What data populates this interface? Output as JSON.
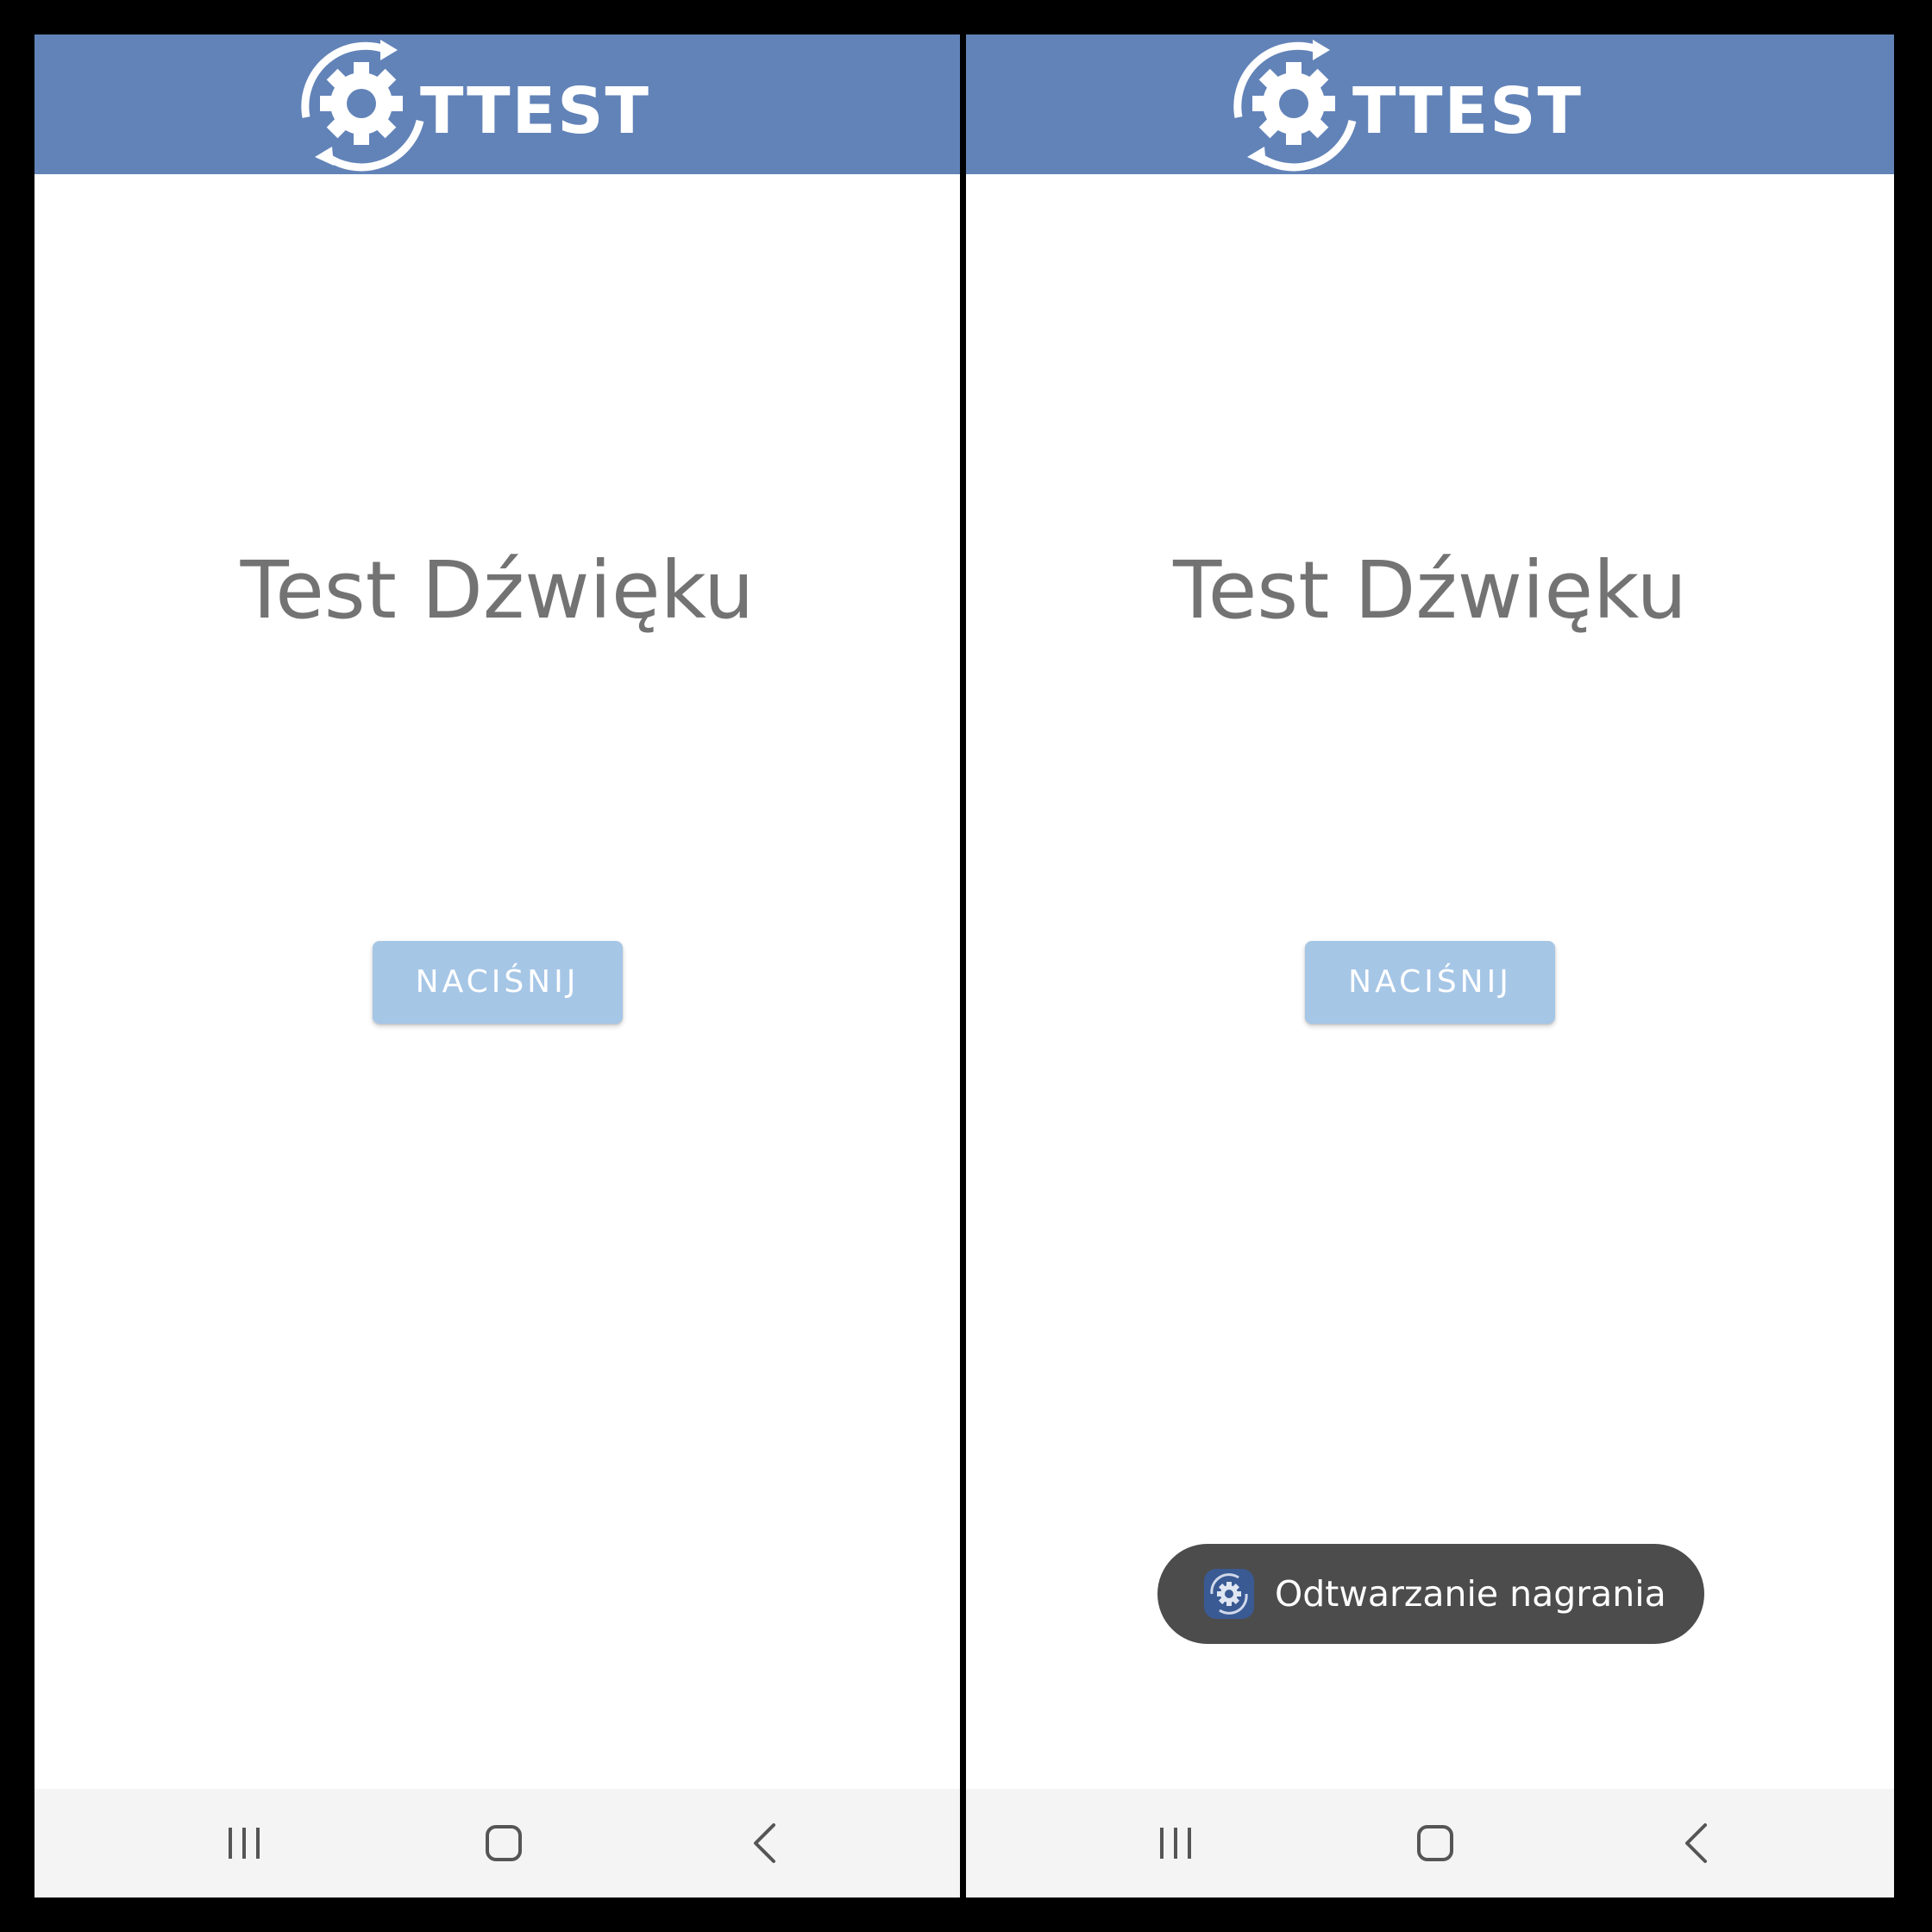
{
  "colors": {
    "header": "#6283b8",
    "title_text": "#737373",
    "button_bg": "#a6c6e6",
    "nav_bar_bg": "#f4f4f4",
    "toast_bg": "#4c4c4c",
    "frame": "#000000"
  },
  "screens": [
    {
      "id": "before-press",
      "header": {
        "logo_text": "TTEST",
        "logo_icon": "gear-refresh-icon"
      },
      "title": "Test Dźwięku",
      "button_label": "NACIŚNIJ",
      "nav_bar": {
        "recent_icon": "recent-apps-icon",
        "home_icon": "home-icon",
        "back_icon": "back-icon"
      }
    },
    {
      "id": "after-press",
      "header": {
        "logo_text": "TTEST",
        "logo_icon": "gear-refresh-icon"
      },
      "title": "Test Dźwięku",
      "button_label": "NACIŚNIJ",
      "toast": {
        "text": "Odtwarzanie nagrania",
        "icon": "app-icon"
      },
      "nav_bar": {
        "recent_icon": "recent-apps-icon",
        "home_icon": "home-icon",
        "back_icon": "back-icon"
      }
    }
  ]
}
